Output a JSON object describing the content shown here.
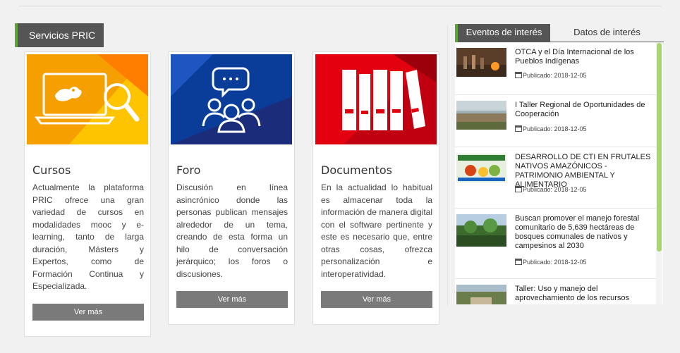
{
  "section": {
    "title": "Servicios PRIC"
  },
  "cards": [
    {
      "title": "Cursos",
      "desc": "Actualmente la plataforma PRIC ofrece una gran variedad de cursos en modalidades mooc y e-learning, tanto de larga duración, Másters y Expertos, como de Formación Continua y Especializada.",
      "button": "Ver más",
      "icon": "laptop-frog-magnifier-icon"
    },
    {
      "title": "Foro",
      "desc": "Discusión en línea asincrónico donde las personas publican mensajes alrededor de un tema, creando de esta forma un hilo de conversación jerárquico; los foros o discusiones.",
      "button": "Ver más",
      "icon": "discussion-group-icon"
    },
    {
      "title": "Documentos",
      "desc": "En la actualidad lo habitual es almacenar toda la información de manera digital con el software pertinente y este es necesario que, entre otras cosas, ofrezca personalización e interoperatividad.",
      "button": "Ver más",
      "icon": "books-icon"
    }
  ],
  "tabs": {
    "active": "Eventos de interés",
    "inactive": "Datos de interés"
  },
  "news": [
    {
      "title": "OTCA y el Día Internacional de los Pueblos Indígenas",
      "date": "Publicado: 2018-12-05"
    },
    {
      "title": "I Taller Regional de Oportunidades de Cooperación",
      "date": "Publicado: 2018-12-05"
    },
    {
      "title": "DESARROLLO DE CTI EN FRUTALES NATIVOS AMAZÓNICOS - PATRIMONIO AMBIENTAL Y ALIMENTARIO",
      "date": "Publicado: 2018-12-05"
    },
    {
      "title": "Buscan promover el manejo forestal comunitario de 5,639 hectáreas de bosques comunales de nativos y campesinos al 2030",
      "date": "Publicado: 2018-12-05"
    },
    {
      "title": "Taller: Uso y manejo del aprovechamiento de los recursos",
      "date": ""
    }
  ],
  "colors": {
    "accent": "#5fa43b",
    "cursos": "#f5a000",
    "foro": "#0a3c9a",
    "documentos": "#e3000f",
    "button": "#7a7a7a"
  }
}
